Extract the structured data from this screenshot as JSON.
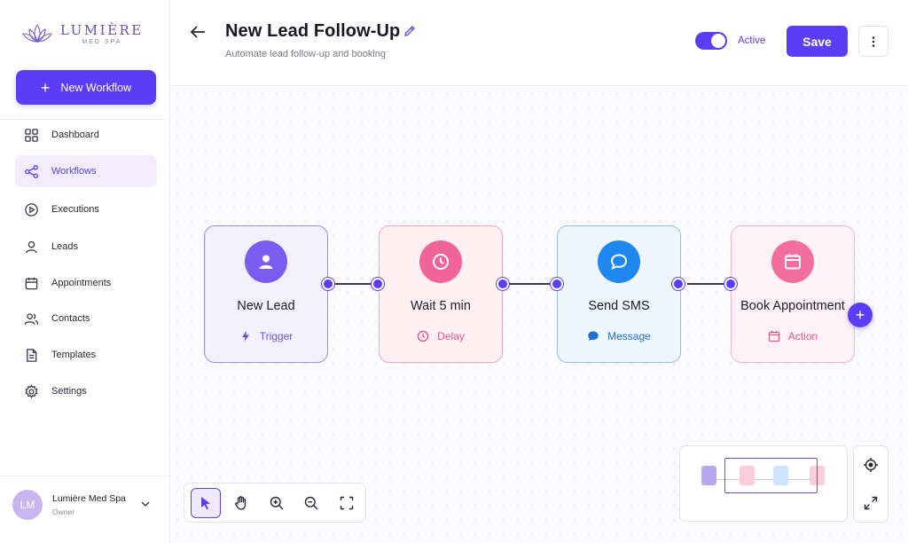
{
  "brand": {
    "name": "LUMIÈRE",
    "tagline": "MED SPA",
    "accent": "#5b3df5"
  },
  "sidebar": {
    "new_button": "New Workflow",
    "items": [
      {
        "label": "Dashboard",
        "icon": "grid-icon"
      },
      {
        "label": "Workflows",
        "icon": "share-nodes-icon",
        "active": true
      },
      {
        "label": "Executions",
        "icon": "play-circle-icon"
      },
      {
        "label": "Leads",
        "icon": "user-icon"
      },
      {
        "label": "Appointments",
        "icon": "calendar-icon"
      },
      {
        "label": "Contacts",
        "icon": "users-icon"
      },
      {
        "label": "Templates",
        "icon": "document-icon"
      },
      {
        "label": "Settings",
        "icon": "gear-icon"
      }
    ],
    "user": {
      "initials": "LM",
      "name": "Lumière Med Spa",
      "role": "Owner"
    }
  },
  "header": {
    "title": "New Lead Follow-Up",
    "subtitle": "Automate lead follow-up and booking",
    "status_label": "Active",
    "status_on": true,
    "save_label": "Save"
  },
  "workflow": {
    "nodes": [
      {
        "label": "New Lead",
        "type": "Trigger",
        "color": "#7b5cf0",
        "icon": "person-icon",
        "type_icon": "lightning-icon"
      },
      {
        "label": "Wait 5 min",
        "type": "Delay",
        "color": "#f0649a",
        "icon": "clock-icon",
        "type_icon": "clock-icon"
      },
      {
        "label": "Send SMS",
        "type": "Message",
        "color": "#1f87f0",
        "icon": "chat-bubble-icon",
        "type_icon": "chat-bubble-icon"
      },
      {
        "label": "Book Appointment",
        "type": "Action",
        "color": "#f26e9c",
        "icon": "calendar-icon",
        "type_icon": "calendar-icon"
      }
    ]
  },
  "toolbar": {
    "tools": [
      "select-pointer-icon",
      "hand-pan-icon",
      "zoom-in-icon",
      "zoom-out-icon",
      "fit-screen-icon"
    ]
  }
}
